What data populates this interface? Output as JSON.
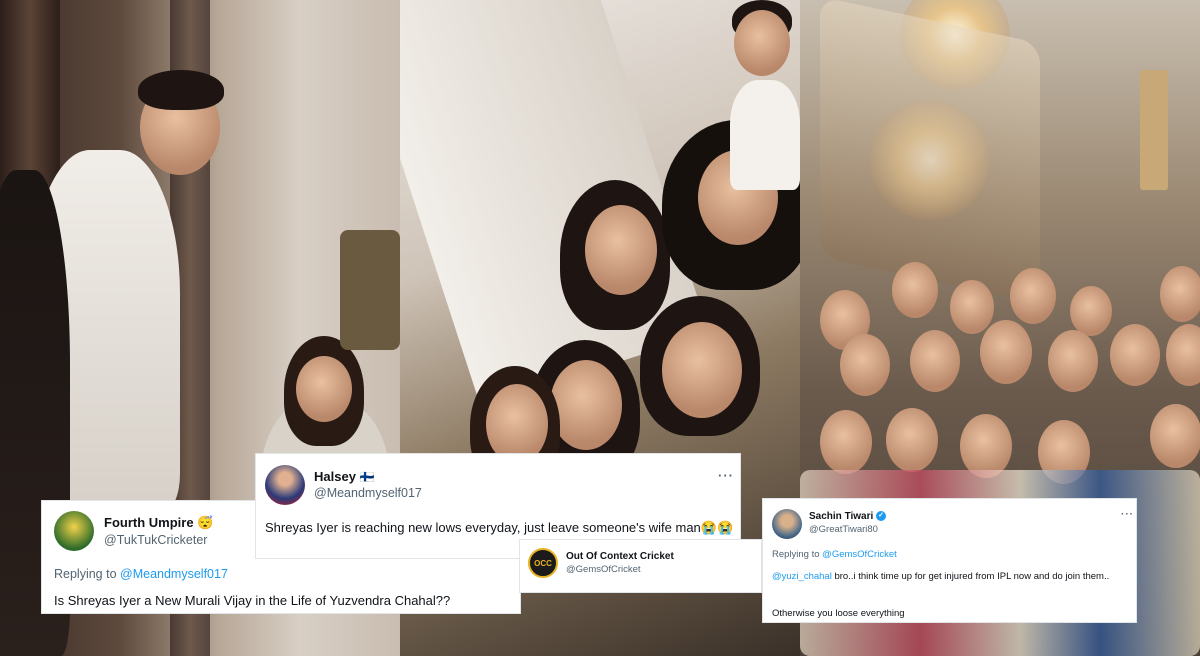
{
  "tweet_fourth_umpire": {
    "name": "Fourth Umpire",
    "emoji": "😴",
    "handle": "@TukTukCricketer",
    "replying_prefix": "Replying to ",
    "replying_handle": "@Meandmyself017",
    "text": "Is Shreyas Iyer a New Murali Vijay in the Life of Yuzvendra Chahal??"
  },
  "tweet_halsey": {
    "name": "Halsey",
    "flag": "🇫🇮",
    "handle": "@Meandmyself017",
    "more": "···",
    "text": "Shreyas Iyer is reaching new lows everyday, just leave someone's wife man",
    "emojis": "😭😭"
  },
  "tweet_occ": {
    "name": "Out Of Context Cricket",
    "handle": "@GemsOfCricket",
    "avatar_text": "OCC"
  },
  "tweet_sachin": {
    "name": "Sachin Tiwari",
    "handle": "@GreatTiwari80",
    "more": "···",
    "replying_prefix": "Replying to ",
    "replying_handle": "@GemsOfCricket",
    "mention": "@yuzi_chahal",
    "text_line1": " bro..i think time up for get injured from IPL now and do join them..",
    "text_line2": "Otherwise you loose everything"
  },
  "colors": {
    "link": "#1d9bf0",
    "secondary": "#536471",
    "verified": "#1d9bf0"
  }
}
